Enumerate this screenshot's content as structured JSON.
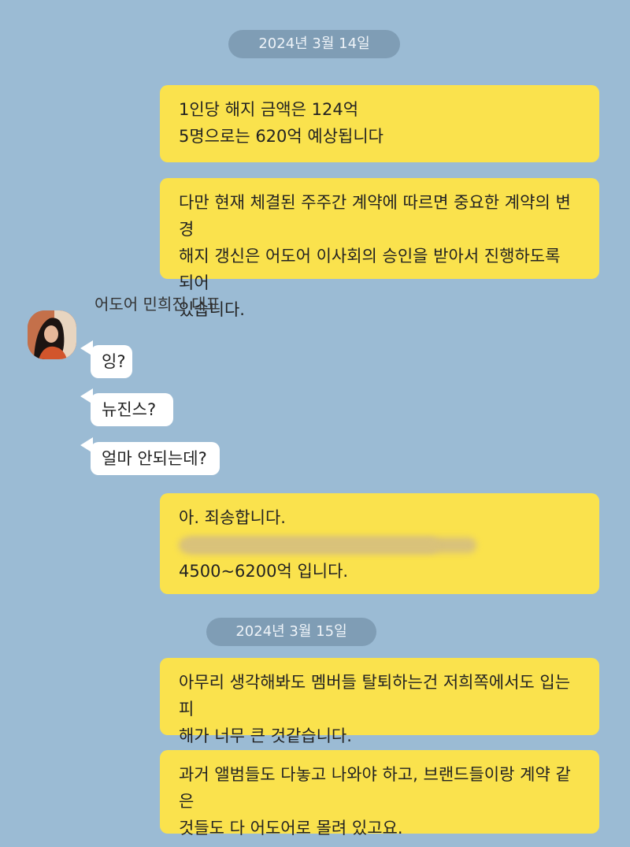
{
  "chat": {
    "dates": [
      "2024년 3월 14일",
      "2024년 3월 15일"
    ],
    "sender_name": "어도어 민희진 대표",
    "messages": [
      {
        "from": "me",
        "text": "1인당 해지 금액은 124억\n5명으로는 620억 예상됩니다"
      },
      {
        "from": "me",
        "text": "다만 현재 체결된 주주간 계약에 따르면 중요한 계약의 변경\n해지 갱신은 어도어 이사회의 승인을 받아서 진행하도록 되어\n있습니다."
      },
      {
        "from": "other",
        "text": "잉?"
      },
      {
        "from": "other",
        "text": "뉴진스?"
      },
      {
        "from": "other",
        "text": "얼마 안되는데?"
      },
      {
        "from": "me",
        "line1": "아. 죄송합니다.",
        "line3": "4500~6200억 입니다."
      },
      {
        "from": "me",
        "text": "아무리 생각해봐도 멤버들 탈퇴하는건 저희쪽에서도 입는 피\n해가 너무 큰 것같습니다."
      },
      {
        "from": "me",
        "text": "과거 앨범들도 다놓고 나와야 하고, 브랜드들이랑 계약 같은\n것들도 다 어도어로 몰려 있고요."
      }
    ]
  },
  "colors": {
    "background": "#9bbbd4",
    "my_bubble": "#fae24d",
    "other_bubble": "#ffffff",
    "date_pill": "#7f9db5"
  },
  "icons": {
    "avatar": "profile-photo"
  }
}
